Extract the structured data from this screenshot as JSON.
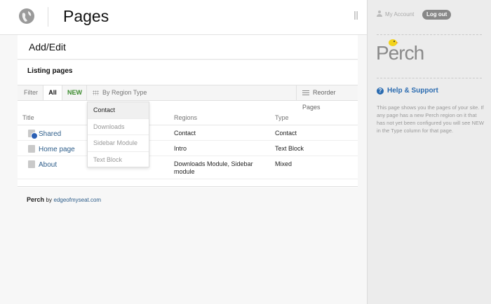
{
  "header": {
    "title": "Pages",
    "icon": "globe-icon"
  },
  "subheader": {
    "title": "Add/Edit"
  },
  "section": {
    "title": "Listing pages"
  },
  "filterbar": {
    "filter_label": "Filter",
    "all_label": "All",
    "new_label": "NEW",
    "region_label": "By Region Type",
    "reorder_label": "Reorder Pages"
  },
  "table": {
    "columns": [
      "Title",
      "Regions",
      "Type"
    ],
    "rows": [
      {
        "title": "Shared",
        "regions": "Contact",
        "type": "Contact",
        "icon": "shared-page-icon"
      },
      {
        "title": "Home page",
        "regions": "Intro",
        "type": "Text Block",
        "icon": "page-icon"
      },
      {
        "title": "About",
        "regions": "Downloads Module, Sidebar module",
        "type": "Mixed",
        "icon": "page-icon"
      }
    ]
  },
  "dropdown": {
    "items": [
      "Contact",
      "Downloads",
      "Sidebar Module",
      "Text Block"
    ],
    "selected": "Contact"
  },
  "footer": {
    "brand": "Perch",
    "by": "by",
    "link": "edgeofmyseat.com"
  },
  "sidebar": {
    "account_label": "My Account",
    "logout_label": "Log out",
    "logo_text": "Perch",
    "help_title": "Help & Support",
    "help_text": "This page shows you the pages of your site. If any page has a new Perch region on it that has not yet been configured you will see NEW in the Type column for that page."
  },
  "colors": {
    "link": "#2d5d8a",
    "new": "#3a8a2c",
    "help": "#2a6bb0",
    "logo_bird": "#f2d31b"
  }
}
